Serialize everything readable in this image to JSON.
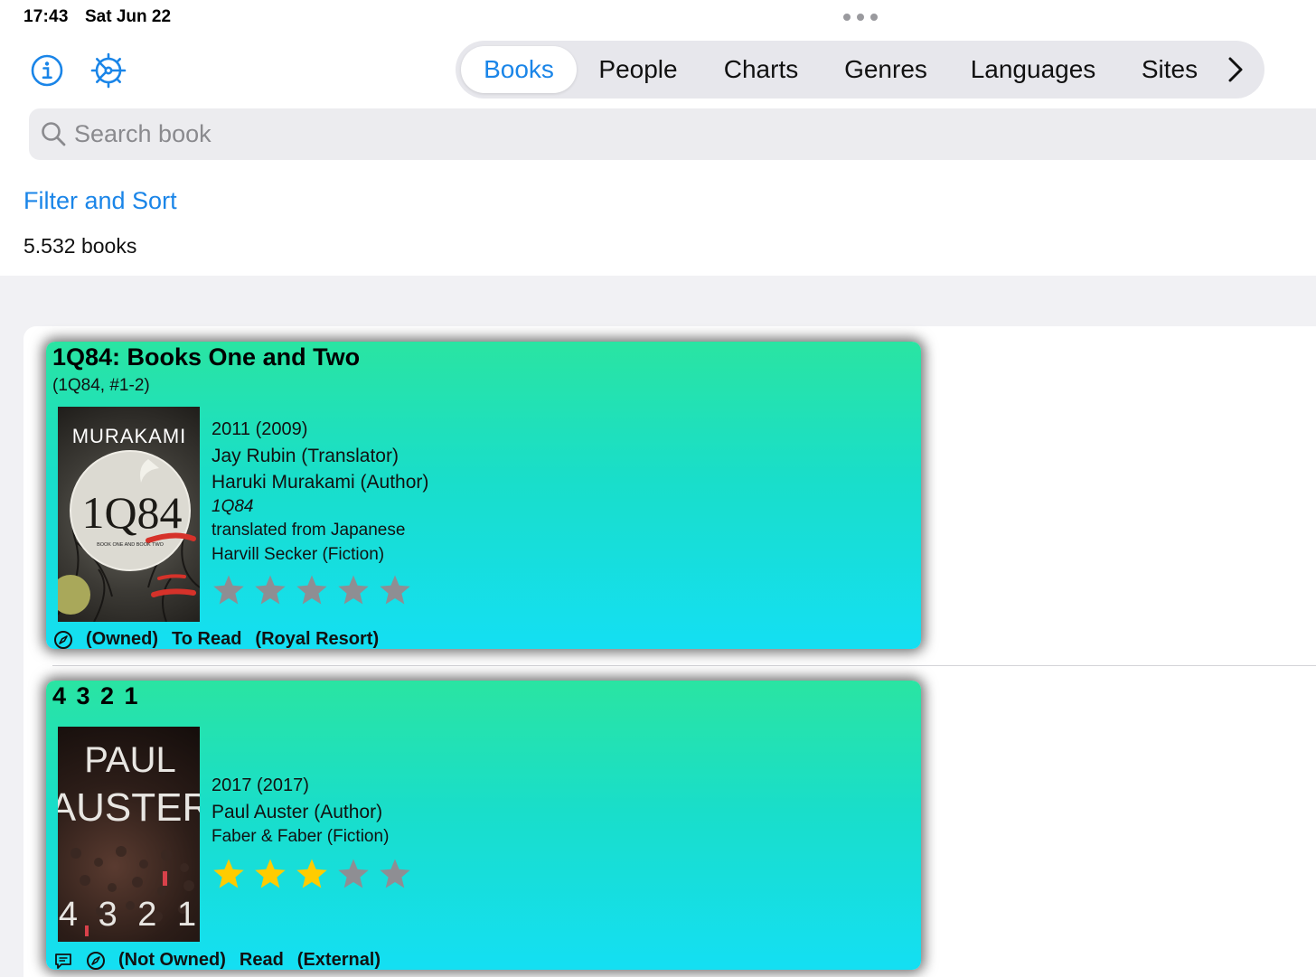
{
  "status": {
    "time": "17:43",
    "date": "Sat Jun 22"
  },
  "nav": {
    "tabs": [
      "Books",
      "People",
      "Charts",
      "Genres",
      "Languages",
      "Sites"
    ],
    "active_tab": "Books"
  },
  "search": {
    "placeholder": "Search book"
  },
  "filter_label": "Filter and Sort",
  "book_count": "5.532 books",
  "colors": {
    "accent": "#1a85e8",
    "star_filled": "#ffcc00",
    "star_empty": "#8e8e93",
    "card_top": "#2ae4a2",
    "card_bottom": "#14dff3"
  },
  "books": [
    {
      "title": "1Q84: Books One and Two",
      "series": "(1Q84, #1-2)",
      "cover": {
        "author_text": "MURAKAMI",
        "title_text": "1Q84",
        "subtitle_text": "BOOK ONE AND BOOK TWO"
      },
      "year": "2011 (2009)",
      "people": [
        "Jay Rubin  (Translator)",
        "Haruki Murakami  (Author)"
      ],
      "original_title": "1Q84",
      "translation_note": " translated from Japanese",
      "publisher": "Harvill Secker  (Fiction)",
      "rating": 0,
      "max_rating": 5,
      "footer": [
        "(Owned)",
        "To Read",
        "(Royal Resort)"
      ]
    },
    {
      "title": "4 3 2 1",
      "cover": {
        "author_line1": "PAUL",
        "author_line2": "AUSTER",
        "title_text": "4 3 2 1"
      },
      "year": "2017 (2017)",
      "people": [
        "Paul Auster  (Author)"
      ],
      "publisher": "Faber & Faber  (Fiction)",
      "rating": 3,
      "max_rating": 5,
      "footer": [
        "(Not Owned)",
        "Read",
        "(External)"
      ]
    }
  ]
}
